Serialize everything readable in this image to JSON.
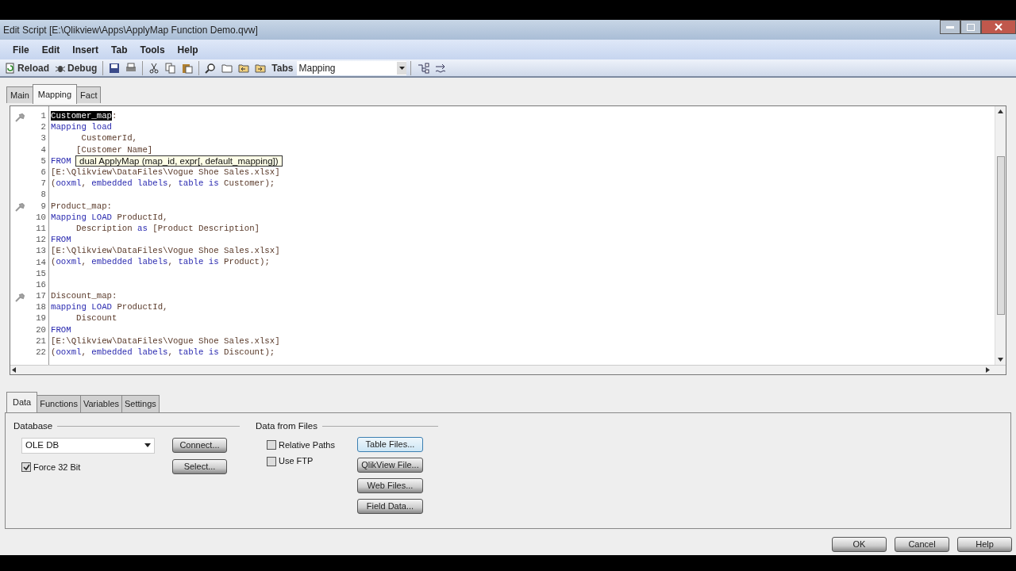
{
  "window": {
    "title": "Edit Script [E:\\Qlikview\\Apps\\ApplyMap Function Demo.qvw]"
  },
  "menu": [
    "File",
    "Edit",
    "Insert",
    "Tab",
    "Tools",
    "Help"
  ],
  "toolbar": {
    "buttons": [
      {
        "kind": "reload",
        "label": "Reload"
      },
      {
        "kind": "debug",
        "label": "Debug"
      }
    ],
    "tabs_label": "Tabs",
    "tabs_value": "Mapping"
  },
  "script_tabs": [
    {
      "label": "Main",
      "selected": false
    },
    {
      "label": "Mapping",
      "selected": true
    },
    {
      "label": "Fact",
      "selected": false
    }
  ],
  "editor": {
    "lines": [
      {
        "number": "1",
        "bookmark": true,
        "tokens": [
          {
            "kind": "selected",
            "text": "Customer_map"
          },
          {
            "kind": "plain",
            "text": ":"
          }
        ]
      },
      {
        "number": "2",
        "bookmark": false,
        "tokens": [
          {
            "kind": "keyword",
            "text": "Mapping load"
          }
        ]
      },
      {
        "number": "3",
        "bookmark": false,
        "tokens": [
          {
            "kind": "plain",
            "text": "      CustomerId,"
          }
        ]
      },
      {
        "number": "4",
        "bookmark": false,
        "tokens": [
          {
            "kind": "plain",
            "text": "     [Customer Name]"
          }
        ]
      },
      {
        "number": "5",
        "bookmark": false,
        "tokens": [
          {
            "kind": "keyword",
            "text": "FROM"
          }
        ]
      },
      {
        "number": "6",
        "bookmark": false,
        "tokens": [
          {
            "kind": "plain",
            "text": "[E:\\Qlikview\\DataFiles\\Vogue Shoe Sales.xlsx]"
          }
        ]
      },
      {
        "number": "7",
        "bookmark": false,
        "tokens": [
          {
            "kind": "plain",
            "text": "("
          },
          {
            "kind": "keyword",
            "text": "ooxml"
          },
          {
            "kind": "plain",
            "text": ", "
          },
          {
            "kind": "keyword",
            "text": "embedded labels"
          },
          {
            "kind": "plain",
            "text": ", "
          },
          {
            "kind": "keyword",
            "text": "table is"
          },
          {
            "kind": "plain",
            "text": " Customer);"
          }
        ]
      },
      {
        "number": "8",
        "bookmark": false
      },
      {
        "number": "9",
        "bookmark": true,
        "tokens": [
          {
            "kind": "plain",
            "text": "Product_map:"
          }
        ]
      },
      {
        "number": "10",
        "bookmark": false,
        "tokens": [
          {
            "kind": "keyword",
            "text": "Mapping LOAD"
          },
          {
            "kind": "plain",
            "text": " ProductId,"
          }
        ]
      },
      {
        "number": "11",
        "bookmark": false,
        "tokens": [
          {
            "kind": "plain",
            "text": "     Description "
          },
          {
            "kind": "keyword",
            "text": "as"
          },
          {
            "kind": "plain",
            "text": " [Product Description]"
          }
        ]
      },
      {
        "number": "12",
        "bookmark": false,
        "tokens": [
          {
            "kind": "keyword",
            "text": "FROM"
          }
        ]
      },
      {
        "number": "13",
        "bookmark": false,
        "tokens": [
          {
            "kind": "plain",
            "text": "[E:\\Qlikview\\DataFiles\\Vogue Shoe Sales.xlsx]"
          }
        ]
      },
      {
        "number": "14",
        "bookmark": false,
        "tokens": [
          {
            "kind": "plain",
            "text": "("
          },
          {
            "kind": "keyword",
            "text": "ooxml"
          },
          {
            "kind": "plain",
            "text": ", "
          },
          {
            "kind": "keyword",
            "text": "embedded labels"
          },
          {
            "kind": "plain",
            "text": ", "
          },
          {
            "kind": "keyword",
            "text": "table is"
          },
          {
            "kind": "plain",
            "text": " Product);"
          }
        ]
      },
      {
        "number": "15",
        "bookmark": false
      },
      {
        "number": "16",
        "bookmark": false
      },
      {
        "number": "17",
        "bookmark": true,
        "tokens": [
          {
            "kind": "plain",
            "text": "Discount_map:"
          }
        ]
      },
      {
        "number": "18",
        "bookmark": false,
        "tokens": [
          {
            "kind": "keyword",
            "text": "mapping LOAD"
          },
          {
            "kind": "plain",
            "text": " ProductId,"
          }
        ]
      },
      {
        "number": "19",
        "bookmark": false,
        "tokens": [
          {
            "kind": "plain",
            "text": "     Discount"
          }
        ]
      },
      {
        "number": "20",
        "bookmark": false,
        "tokens": [
          {
            "kind": "keyword",
            "text": "FROM"
          }
        ]
      },
      {
        "number": "21",
        "bookmark": false,
        "tokens": [
          {
            "kind": "plain",
            "text": "[E:\\Qlikview\\DataFiles\\Vogue Shoe Sales.xlsx]"
          }
        ]
      },
      {
        "number": "22",
        "bookmark": false,
        "tokens": [
          {
            "kind": "plain",
            "text": "("
          },
          {
            "kind": "keyword",
            "text": "ooxml"
          },
          {
            "kind": "plain",
            "text": ", "
          },
          {
            "kind": "keyword",
            "text": "embedded labels"
          },
          {
            "kind": "plain",
            "text": ", "
          },
          {
            "kind": "keyword",
            "text": "table is"
          },
          {
            "kind": "plain",
            "text": " Discount);"
          }
        ]
      }
    ],
    "tooltip": "dual ApplyMap (map_id, expr[, default_mapping])"
  },
  "panel_tabs": [
    {
      "label": "Data",
      "selected": true
    },
    {
      "label": "Functions",
      "selected": false
    },
    {
      "label": "Variables",
      "selected": false
    },
    {
      "label": "Settings",
      "selected": false
    }
  ],
  "database": {
    "legend": "Database",
    "select_value": "OLE DB",
    "buttons": [
      "Connect...",
      "Select..."
    ],
    "force_32bit": {
      "label": "Force 32 Bit",
      "checked": true
    }
  },
  "data_from_files": {
    "legend": "Data from Files",
    "checkboxes": [
      {
        "label": "Relative Paths",
        "checked": false
      },
      {
        "label": "Use FTP",
        "checked": false
      }
    ],
    "buttons": [
      {
        "label": "Table Files...",
        "focused": true
      },
      {
        "label": "QlikView File...",
        "focused": false
      },
      {
        "label": "Web Files...",
        "focused": false
      },
      {
        "label": "Field Data...",
        "focused": false
      }
    ]
  },
  "footer_buttons": [
    "OK",
    "Cancel",
    "Help"
  ]
}
